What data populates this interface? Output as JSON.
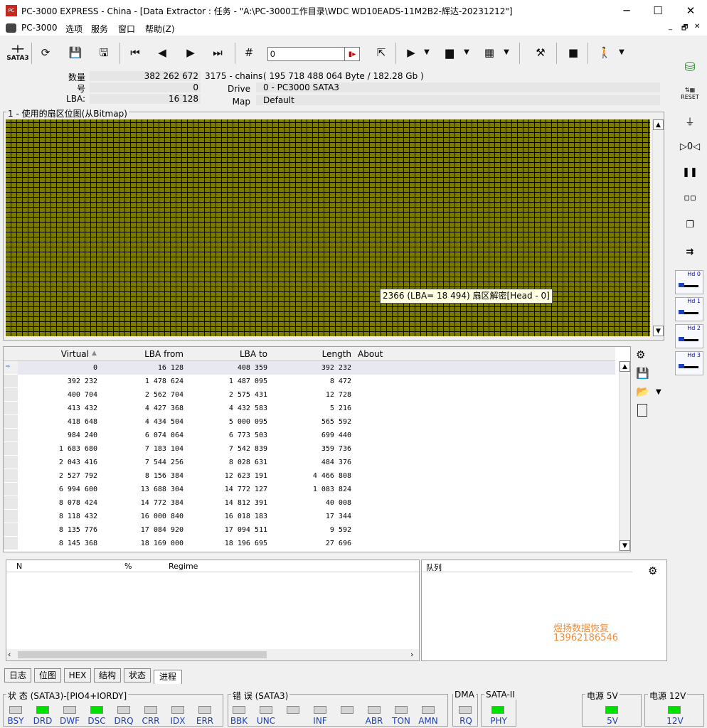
{
  "window": {
    "title": "PC-3000 EXPRESS - China - [Data Extractor : 任务 - \"A:\\PC-3000工作目录\\WDC WD10EADS-11M2B2-辉达-20231212\"]",
    "minimize": "─",
    "maximize": "☐",
    "close": "✕"
  },
  "menu": {
    "items": [
      "PC-3000",
      "选项",
      "服务",
      "窗口",
      "帮助(Z)"
    ],
    "mdi_controls": [
      "_",
      "🗗",
      "✕"
    ]
  },
  "toolbar": {
    "sata_label": "SATA3",
    "lba_input": "0"
  },
  "info": {
    "count_label": "数量",
    "count_value": "382 262 672",
    "chains": "3175 - chains",
    "bytes": "( 195 718 488 064 Byte /  182.28 Gb )",
    "num_label": "号",
    "num_value": "0",
    "drive_label": "Drive",
    "drive_value": "0 - PC3000 SATA3",
    "lba_label": "LBA:",
    "lba_value": "16 128",
    "map_label": "Map",
    "map_value": "Default"
  },
  "bitmap": {
    "frame_label": "1 - 使用的扇区位图(从Bitmap)",
    "tooltip": "2366 (LBA=  18 494) 扇区解密[Head - 0]"
  },
  "table": {
    "columns": [
      "Virtual",
      "LBA from",
      "LBA to",
      "Length",
      "About"
    ],
    "rows": [
      [
        "0",
        "16 128",
        "408 359",
        "392 232"
      ],
      [
        "392 232",
        "1 478 624",
        "1 487 095",
        "8 472"
      ],
      [
        "400 704",
        "2 562 704",
        "2 575 431",
        "12 728"
      ],
      [
        "413 432",
        "4 427 368",
        "4 432 583",
        "5 216"
      ],
      [
        "418 648",
        "4 434 504",
        "5 000 095",
        "565 592"
      ],
      [
        "984 240",
        "6 074 064",
        "6 773 503",
        "699 440"
      ],
      [
        "1 683 680",
        "7 183 104",
        "7 542 839",
        "359 736"
      ],
      [
        "2 043 416",
        "7 544 256",
        "8 028 631",
        "484 376"
      ],
      [
        "2 527 792",
        "8 156 384",
        "12 623 191",
        "4 466 808"
      ],
      [
        "6 994 600",
        "13 688 304",
        "14 772 127",
        "1 083 824"
      ],
      [
        "8 078 424",
        "14 772 384",
        "14 812 391",
        "40 008"
      ],
      [
        "8 118 432",
        "16 000 840",
        "16 018 183",
        "17 344"
      ],
      [
        "8 135 776",
        "17 084 920",
        "17 094 511",
        "9 592"
      ],
      [
        "8 145 368",
        "18 169 000",
        "18 196 695",
        "27 696"
      ]
    ]
  },
  "bottom": {
    "col_n": "N",
    "col_pct": "%",
    "col_regime": "Regime",
    "queue": "队列",
    "watermark_name": "煜扬数据恢复",
    "watermark_phone": "13962186546"
  },
  "tabs": [
    "日志",
    "位图",
    "HEX",
    "结构",
    "状态",
    "进程"
  ],
  "status": {
    "state_group": "状 态 (SATA3)-[PIO4+IORDY]",
    "state_leds": [
      {
        "label": "BSY",
        "on": false
      },
      {
        "label": "DRD",
        "on": true
      },
      {
        "label": "DWF",
        "on": false
      },
      {
        "label": "DSC",
        "on": true
      },
      {
        "label": "DRQ",
        "on": false
      },
      {
        "label": "CRR",
        "on": false
      },
      {
        "label": "IDX",
        "on": false
      },
      {
        "label": "ERR",
        "on": false
      }
    ],
    "error_group": "错 误 (SATA3)",
    "error_leds": [
      {
        "label": "BBK",
        "on": false
      },
      {
        "label": "UNC",
        "on": false
      },
      {
        "label": "",
        "on": false
      },
      {
        "label": "INF",
        "on": false
      },
      {
        "label": "",
        "on": false
      },
      {
        "label": "ABR",
        "on": false
      },
      {
        "label": "TON",
        "on": false
      },
      {
        "label": "AMN",
        "on": false
      }
    ],
    "dma_group": "DMA",
    "dma_led": "RQ",
    "sata_group": "SATA-II",
    "sata_led": "PHY",
    "p5_group": "电源 5V",
    "p5_led": "5V",
    "p12_group": "电源 12V",
    "p12_led": "12V"
  },
  "sidebar": {
    "reset": "RESET",
    "hd": [
      "Hd 0",
      "Hd 1",
      "Hd 2",
      "Hd 3"
    ]
  },
  "colors": {
    "bitmap_cell": "#7a7a00",
    "led_on": "#00e000",
    "led_label": "#1a3fbf",
    "watermark": "#f08c3c"
  }
}
